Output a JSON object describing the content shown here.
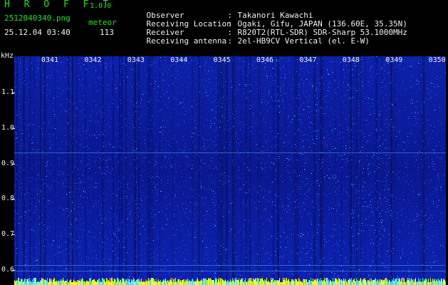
{
  "app": {
    "logo": "H R O F F T",
    "version": "1.0.0"
  },
  "capture": {
    "filename": "2512040340.png",
    "datetime": "25.12.04 03:40",
    "meteor_label": "meteor",
    "meteor_count": "113"
  },
  "info": [
    {
      "key": "Observer",
      "value": "Takanori Kawachi"
    },
    {
      "key": "Receiving Location",
      "value": "Ogaki, Gifu, JAPAN (136.60E, 35.35N)"
    },
    {
      "key": "Receiver",
      "value": "R820T2(RTL-SDR) SDR-Sharp 53.1000MHz"
    },
    {
      "key": "Receiving antenna",
      "value": "2el-HB9CV Vertical (el. E-W)"
    }
  ],
  "axis": {
    "y_unit": "kHz",
    "y_ticks": [
      "1.1",
      "1.0",
      "0.9",
      "0.8",
      "0.7",
      "0.6"
    ],
    "y_values": [
      1.1,
      1.0,
      0.9,
      0.8,
      0.7,
      0.6
    ],
    "time_ticks": [
      "0341",
      "0342",
      "0343",
      "0344",
      "0345",
      "0346",
      "0347",
      "0348",
      "0349",
      "0350"
    ]
  },
  "colors": {
    "bg": "#0a1890",
    "noise_low": "#1830d0",
    "noise_mid": "#2a70ff",
    "noise_high": "#30e0ff",
    "hot": "#f0f060",
    "bottom_band": "#ffff00"
  }
}
